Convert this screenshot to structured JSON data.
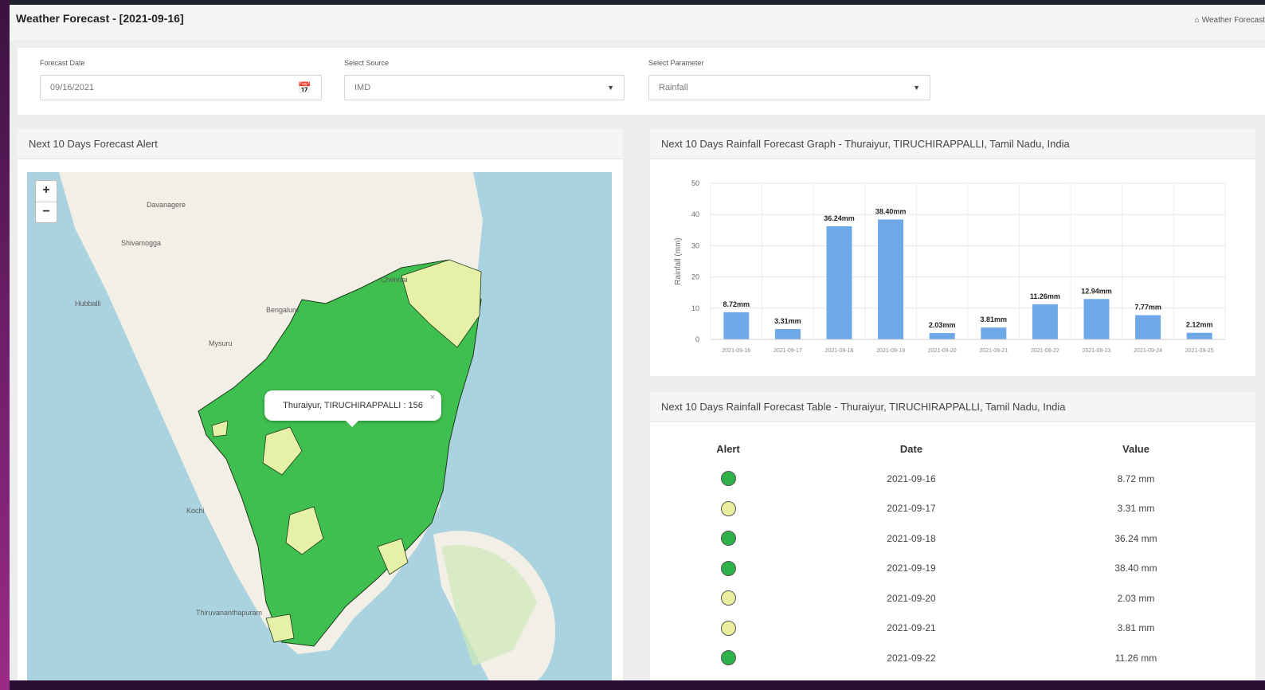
{
  "header": {
    "title": "Weather Forecast - [2021-09-16]",
    "breadcrumb": "Weather Forecast"
  },
  "filters": {
    "date": {
      "label": "Forecast Date",
      "value": "09/16/2021"
    },
    "source": {
      "label": "Select Source",
      "value": "IMD"
    },
    "parameter": {
      "label": "Select Parameter",
      "value": "Rainfall"
    }
  },
  "map_card": {
    "title": "Next 10 Days Forecast Alert",
    "zoom_in": "+",
    "zoom_out": "−",
    "popup_text": "Thuraiyur, TIRUCHIRAPPALLI : 156",
    "popup_close": "×",
    "place_labels": [
      "Davanagere",
      "Shivamogga",
      "Bengaluru",
      "Mysuru",
      "Chennai",
      "Kochi",
      "Thiruvananthapuram",
      "Hubballi"
    ],
    "colors": {
      "green": "#3fbf4f",
      "light": "#e6f0a6",
      "land": "#f2efe6",
      "water": "#aad3df",
      "border": "#1b3a1b"
    }
  },
  "chart_card": {
    "title": "Next 10 Days Rainfall Forecast Graph - Thuraiyur, TIRUCHIRAPPALLI, Tamil Nadu, India"
  },
  "chart_data": {
    "type": "bar",
    "categories": [
      "2021-09-16",
      "2021-09-17",
      "2021-09-18",
      "2021-09-19",
      "2021-09-20",
      "2021-09-21",
      "2021-09-22",
      "2021-09-23",
      "2021-09-24",
      "2021-09-25"
    ],
    "values": [
      8.72,
      3.31,
      36.24,
      38.4,
      2.03,
      3.81,
      11.26,
      12.94,
      7.77,
      2.12
    ],
    "value_labels": [
      "8.72mm",
      "3.31mm",
      "36.24mm",
      "38.40mm",
      "2.03mm",
      "3.81mm",
      "11.26mm",
      "12.94mm",
      "7.77mm",
      "2.12mm"
    ],
    "ylabel": "Rainfall (mm)",
    "ylim": [
      0,
      50
    ],
    "yticks": [
      0,
      10,
      20,
      30,
      40,
      50
    ],
    "bar_color": "#6fa8e6",
    "grid": true
  },
  "table_card": {
    "title": "Next 10 Days Rainfall Forecast Table - Thuraiyur, TIRUCHIRAPPALLI, Tamil Nadu, India",
    "columns": [
      "Alert",
      "Date",
      "Value"
    ],
    "rows": [
      {
        "alert": "green",
        "date": "2021-09-16",
        "value": "8.72 mm"
      },
      {
        "alert": "light",
        "date": "2021-09-17",
        "value": "3.31 mm"
      },
      {
        "alert": "green",
        "date": "2021-09-18",
        "value": "36.24 mm"
      },
      {
        "alert": "green",
        "date": "2021-09-19",
        "value": "38.40 mm"
      },
      {
        "alert": "light",
        "date": "2021-09-20",
        "value": "2.03 mm"
      },
      {
        "alert": "light",
        "date": "2021-09-21",
        "value": "3.81 mm"
      },
      {
        "alert": "green",
        "date": "2021-09-22",
        "value": "11.26 mm"
      }
    ],
    "alert_colors": {
      "green": "#2fb14a",
      "light": "#e8ee9c"
    }
  }
}
